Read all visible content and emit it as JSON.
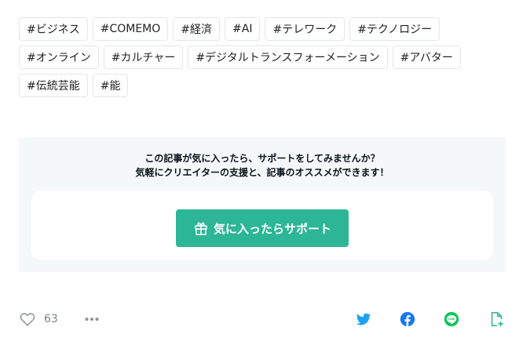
{
  "tags": [
    "#ビジネス",
    "#COMEMO",
    "#経済",
    "#AI",
    "#テレワーク",
    "#テクノロジー",
    "#オンライン",
    "#カルチャー",
    "#デジタルトランスフォーメーション",
    "#アバター",
    "#伝統芸能",
    "#能"
  ],
  "support": {
    "line1": "この記事が気に入ったら、サポートをしてみませんか？",
    "line2": "気軽にクリエイターの支援と、記事のオススメができます！",
    "button_label": "気に入ったらサポート",
    "button_color": "#2cb696"
  },
  "actions": {
    "like_count": "63",
    "icons": [
      "heart-icon",
      "more-icon",
      "twitter-icon",
      "facebook-icon",
      "line-icon",
      "add-magazine-icon"
    ]
  }
}
